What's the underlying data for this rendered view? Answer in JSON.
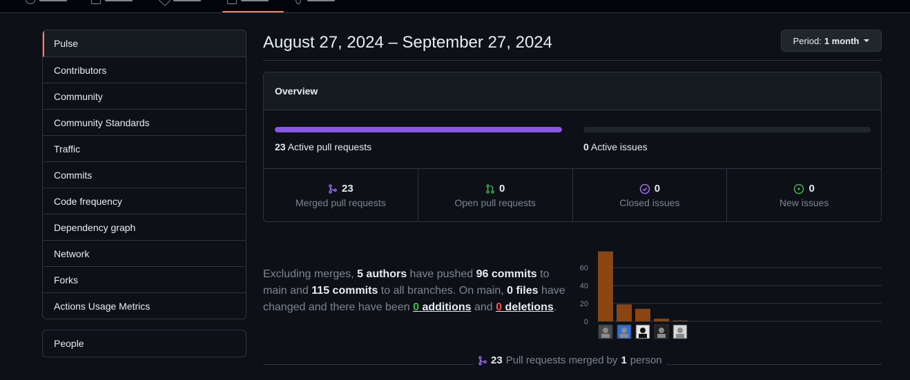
{
  "colors": {
    "background": "#0d1117",
    "border": "#30363d",
    "accent_active_tab": "#f78166",
    "merged_purple": "#8957e5",
    "open_green": "#3fb950",
    "deletions_red": "#f85149",
    "bar_brown": "#8b4513"
  },
  "sidebar": {
    "items": [
      {
        "label": "Pulse",
        "active": true
      },
      {
        "label": "Contributors"
      },
      {
        "label": "Community"
      },
      {
        "label": "Community Standards"
      },
      {
        "label": "Traffic"
      },
      {
        "label": "Commits"
      },
      {
        "label": "Code frequency"
      },
      {
        "label": "Dependency graph"
      },
      {
        "label": "Network"
      },
      {
        "label": "Forks"
      },
      {
        "label": "Actions Usage Metrics"
      }
    ],
    "people_label": "People"
  },
  "header": {
    "date_range": "August 27, 2024 – September 27, 2024",
    "period_prefix": "Period:",
    "period_value": "1 month"
  },
  "overview": {
    "title": "Overview",
    "active_pr_count": "23",
    "active_pr_label": "Active pull requests",
    "active_pr_fraction": 1.0,
    "active_issues_count": "0",
    "active_issues_label": "Active issues",
    "active_issues_fraction": 0.0,
    "stats": [
      {
        "value": "23",
        "label": "Merged pull requests",
        "icon": "git-merge-icon"
      },
      {
        "value": "0",
        "label": "Open pull requests",
        "icon": "git-pull-request-icon"
      },
      {
        "value": "0",
        "label": "Closed issues",
        "icon": "issue-closed-icon"
      },
      {
        "value": "0",
        "label": "New issues",
        "icon": "issue-opened-icon"
      }
    ]
  },
  "summary": {
    "t1": "Excluding merges,",
    "authors": "5 authors",
    "t2": "have pushed",
    "commits_main": "96 commits",
    "t3": "to main and",
    "commits_all": "115 commits",
    "t4": "to all branches. On main,",
    "files": "0 files",
    "t5": "have changed and there have been",
    "additions_n": "0",
    "additions_w": "additions",
    "t6": "and",
    "deletions_n": "0",
    "deletions_w": "deletions",
    "t7": "."
  },
  "chart_data": {
    "type": "bar",
    "categories": [
      "author-1",
      "author-2",
      "author-3",
      "author-4",
      "author-5"
    ],
    "values": [
      78,
      19,
      14,
      3,
      1
    ],
    "yticks": [
      "0",
      "20",
      "40",
      "60"
    ],
    "ylim": [
      0,
      80
    ]
  },
  "footer": {
    "count": "23",
    "text": "Pull requests merged by",
    "people_count": "1",
    "people_word": "person"
  }
}
